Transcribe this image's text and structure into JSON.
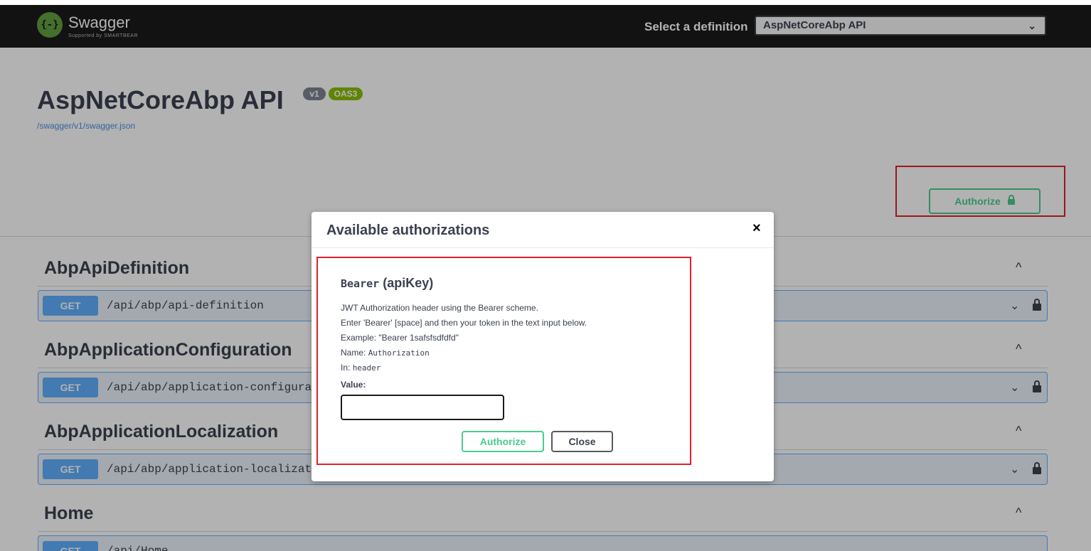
{
  "header": {
    "logo_glyph": "{-}",
    "logo_text": "Swagger",
    "logo_sub": "Supported by SMARTBEAR",
    "definition_label": "Select a definition",
    "definition_selected": "AspNetCoreAbp API",
    "chevron": "⌄"
  },
  "info": {
    "title": "AspNetCoreAbp API",
    "version_badge": "v1",
    "oas_badge": "OAS3",
    "url": "/swagger/v1/swagger.json",
    "authorize_label": "Authorize"
  },
  "tags": [
    {
      "name": "AbpApiDefinition",
      "chevron": "^",
      "op": {
        "method": "GET",
        "path": "/api/abp/api-definition",
        "chevron": "⌄"
      }
    },
    {
      "name": "AbpApplicationConfiguration",
      "chevron": "^",
      "op": {
        "method": "GET",
        "path": "/api/abp/application-configurati",
        "chevron": "⌄"
      }
    },
    {
      "name": "AbpApplicationLocalization",
      "chevron": "^",
      "op": {
        "method": "GET",
        "path": "/api/abp/application-localizatio",
        "chevron": "⌄"
      }
    },
    {
      "name": "Home",
      "chevron": "^",
      "op": {
        "method": "GET",
        "path": "/api/Home",
        "chevron": "⌄"
      }
    }
  ],
  "modal": {
    "title": "Available authorizations",
    "close_glyph": "×",
    "scheme_name": "Bearer",
    "scheme_type": "(apiKey)",
    "desc_line1": "JWT Authorization header using the Bearer scheme.",
    "desc_line2": "Enter 'Bearer' [space] and then your token in the text input below.",
    "desc_line3": "Example: \"Bearer 1safsfsdfdfd\"",
    "name_label": "Name: ",
    "name_value": "Authorization",
    "in_label": "In: ",
    "in_value": "header",
    "value_label": "Value:",
    "value_input": "",
    "authorize_label": "Authorize",
    "close_label": "Close"
  },
  "colors": {
    "topbar": "#1b1b1b",
    "get": "#61affe",
    "authorize_green": "#49cc90",
    "highlight_red": "#e0202a"
  }
}
